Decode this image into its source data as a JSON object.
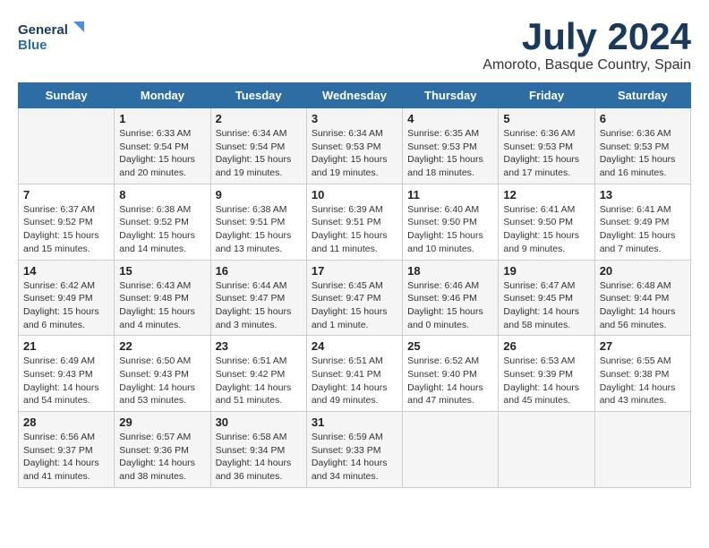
{
  "header": {
    "logo_line1": "General",
    "logo_line2": "Blue",
    "month_title": "July 2024",
    "location": "Amoroto, Basque Country, Spain"
  },
  "weekdays": [
    "Sunday",
    "Monday",
    "Tuesday",
    "Wednesday",
    "Thursday",
    "Friday",
    "Saturday"
  ],
  "weeks": [
    [
      {
        "day": "",
        "info": ""
      },
      {
        "day": "1",
        "info": "Sunrise: 6:33 AM\nSunset: 9:54 PM\nDaylight: 15 hours\nand 20 minutes."
      },
      {
        "day": "2",
        "info": "Sunrise: 6:34 AM\nSunset: 9:54 PM\nDaylight: 15 hours\nand 19 minutes."
      },
      {
        "day": "3",
        "info": "Sunrise: 6:34 AM\nSunset: 9:53 PM\nDaylight: 15 hours\nand 19 minutes."
      },
      {
        "day": "4",
        "info": "Sunrise: 6:35 AM\nSunset: 9:53 PM\nDaylight: 15 hours\nand 18 minutes."
      },
      {
        "day": "5",
        "info": "Sunrise: 6:36 AM\nSunset: 9:53 PM\nDaylight: 15 hours\nand 17 minutes."
      },
      {
        "day": "6",
        "info": "Sunrise: 6:36 AM\nSunset: 9:53 PM\nDaylight: 15 hours\nand 16 minutes."
      }
    ],
    [
      {
        "day": "7",
        "info": "Sunrise: 6:37 AM\nSunset: 9:52 PM\nDaylight: 15 hours\nand 15 minutes."
      },
      {
        "day": "8",
        "info": "Sunrise: 6:38 AM\nSunset: 9:52 PM\nDaylight: 15 hours\nand 14 minutes."
      },
      {
        "day": "9",
        "info": "Sunrise: 6:38 AM\nSunset: 9:51 PM\nDaylight: 15 hours\nand 13 minutes."
      },
      {
        "day": "10",
        "info": "Sunrise: 6:39 AM\nSunset: 9:51 PM\nDaylight: 15 hours\nand 11 minutes."
      },
      {
        "day": "11",
        "info": "Sunrise: 6:40 AM\nSunset: 9:50 PM\nDaylight: 15 hours\nand 10 minutes."
      },
      {
        "day": "12",
        "info": "Sunrise: 6:41 AM\nSunset: 9:50 PM\nDaylight: 15 hours\nand 9 minutes."
      },
      {
        "day": "13",
        "info": "Sunrise: 6:41 AM\nSunset: 9:49 PM\nDaylight: 15 hours\nand 7 minutes."
      }
    ],
    [
      {
        "day": "14",
        "info": "Sunrise: 6:42 AM\nSunset: 9:49 PM\nDaylight: 15 hours\nand 6 minutes."
      },
      {
        "day": "15",
        "info": "Sunrise: 6:43 AM\nSunset: 9:48 PM\nDaylight: 15 hours\nand 4 minutes."
      },
      {
        "day": "16",
        "info": "Sunrise: 6:44 AM\nSunset: 9:47 PM\nDaylight: 15 hours\nand 3 minutes."
      },
      {
        "day": "17",
        "info": "Sunrise: 6:45 AM\nSunset: 9:47 PM\nDaylight: 15 hours\nand 1 minute."
      },
      {
        "day": "18",
        "info": "Sunrise: 6:46 AM\nSunset: 9:46 PM\nDaylight: 15 hours\nand 0 minutes."
      },
      {
        "day": "19",
        "info": "Sunrise: 6:47 AM\nSunset: 9:45 PM\nDaylight: 14 hours\nand 58 minutes."
      },
      {
        "day": "20",
        "info": "Sunrise: 6:48 AM\nSunset: 9:44 PM\nDaylight: 14 hours\nand 56 minutes."
      }
    ],
    [
      {
        "day": "21",
        "info": "Sunrise: 6:49 AM\nSunset: 9:43 PM\nDaylight: 14 hours\nand 54 minutes."
      },
      {
        "day": "22",
        "info": "Sunrise: 6:50 AM\nSunset: 9:43 PM\nDaylight: 14 hours\nand 53 minutes."
      },
      {
        "day": "23",
        "info": "Sunrise: 6:51 AM\nSunset: 9:42 PM\nDaylight: 14 hours\nand 51 minutes."
      },
      {
        "day": "24",
        "info": "Sunrise: 6:51 AM\nSunset: 9:41 PM\nDaylight: 14 hours\nand 49 minutes."
      },
      {
        "day": "25",
        "info": "Sunrise: 6:52 AM\nSunset: 9:40 PM\nDaylight: 14 hours\nand 47 minutes."
      },
      {
        "day": "26",
        "info": "Sunrise: 6:53 AM\nSunset: 9:39 PM\nDaylight: 14 hours\nand 45 minutes."
      },
      {
        "day": "27",
        "info": "Sunrise: 6:55 AM\nSunset: 9:38 PM\nDaylight: 14 hours\nand 43 minutes."
      }
    ],
    [
      {
        "day": "28",
        "info": "Sunrise: 6:56 AM\nSunset: 9:37 PM\nDaylight: 14 hours\nand 41 minutes."
      },
      {
        "day": "29",
        "info": "Sunrise: 6:57 AM\nSunset: 9:36 PM\nDaylight: 14 hours\nand 38 minutes."
      },
      {
        "day": "30",
        "info": "Sunrise: 6:58 AM\nSunset: 9:34 PM\nDaylight: 14 hours\nand 36 minutes."
      },
      {
        "day": "31",
        "info": "Sunrise: 6:59 AM\nSunset: 9:33 PM\nDaylight: 14 hours\nand 34 minutes."
      },
      {
        "day": "",
        "info": ""
      },
      {
        "day": "",
        "info": ""
      },
      {
        "day": "",
        "info": ""
      }
    ]
  ]
}
